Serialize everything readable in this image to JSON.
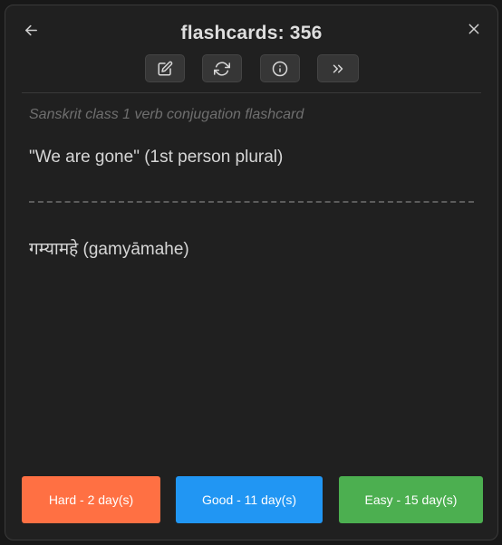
{
  "modal": {
    "title": "flashcards: 356"
  },
  "icons": {
    "back": "arrow-left-icon",
    "close": "close-icon",
    "edit": "edit-icon",
    "reset": "refresh-icon",
    "info": "info-icon",
    "skip": "chevrons-right-icon"
  },
  "card": {
    "context": "Sanskrit class 1 verb conjugation flashcard",
    "question": "\"We are gone\" (1st person plural)",
    "answer": "गम्यामहे (gamyāmahe)"
  },
  "responses": [
    {
      "label": "Hard - 2 day(s)",
      "color": "#ff7043"
    },
    {
      "label": "Good - 11 day(s)",
      "color": "#2196f3"
    },
    {
      "label": "Easy - 15 day(s)",
      "color": "#4caf50"
    }
  ],
  "colors": {
    "background": "#202020",
    "text": "#d6d6d6",
    "muted": "#6f6f6f"
  }
}
